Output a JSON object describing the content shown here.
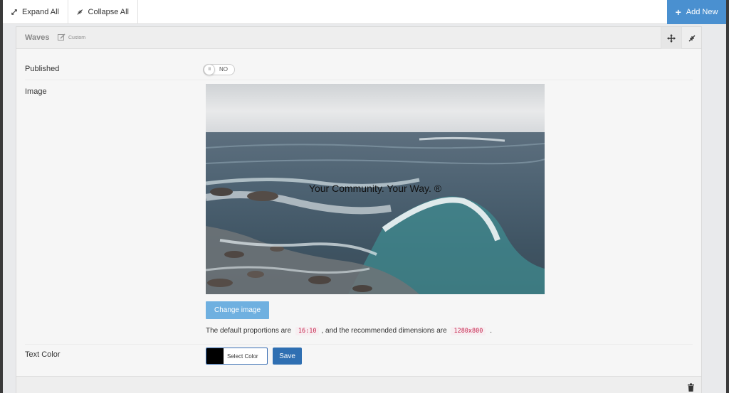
{
  "toolbar": {
    "expand_label": "Expand All",
    "collapse_label": "Collapse All",
    "add_label": "Add New",
    "expand_icon": "expand-arrows-icon",
    "collapse_icon": "compress-arrows-icon",
    "add_icon": "plus-icon",
    "accent_color": "#4a90d0"
  },
  "panel": {
    "title": "Waves",
    "badge": "Custom",
    "move_icon": "move-arrows-icon",
    "collapse_icon": "compress-arrows-icon",
    "delete_icon": "trash-icon"
  },
  "fields": {
    "published": {
      "label": "Published",
      "knob_text": "III",
      "state_label": "NO"
    },
    "image": {
      "label": "Image",
      "overlay_text": "Your Community. Your Way. ®",
      "change_label": "Change image",
      "help_prefix": "The default proportions are",
      "ratio": "16:10",
      "help_middle": ", and the recommended dimensions are",
      "dimensions": "1280x800",
      "help_suffix": "."
    },
    "text_color": {
      "label": "Text Color",
      "select_label": "Select Color",
      "swatch_color": "#000000",
      "save_label": "Save",
      "save_color": "#2f6fb2"
    }
  }
}
